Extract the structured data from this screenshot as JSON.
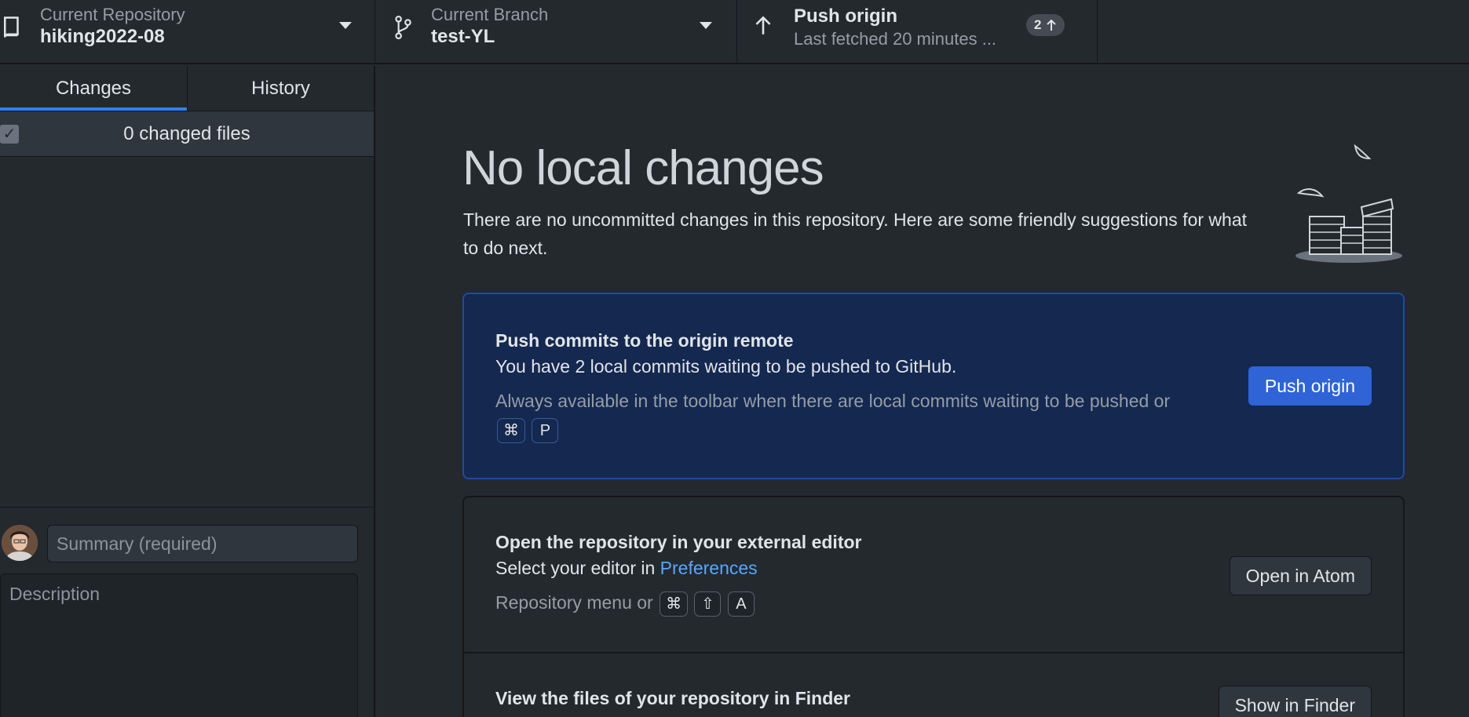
{
  "toolbar": {
    "repository": {
      "label": "Current Repository",
      "value": "hiking2022-08"
    },
    "branch": {
      "label": "Current Branch",
      "value": "test-YL"
    },
    "push": {
      "title": "Push origin",
      "subtitle": "Last fetched 20 minutes ...",
      "count": "2"
    }
  },
  "sidebar": {
    "tabs": [
      {
        "label": "Changes",
        "active": true
      },
      {
        "label": "History",
        "active": false
      }
    ],
    "files_count": "0 changed files",
    "summary_placeholder": "Summary (required)",
    "description_placeholder": "Description"
  },
  "main": {
    "headline": "No local changes",
    "intro": "There are no uncommitted changes in this repository. Here are some friendly suggestions for what to do next.",
    "push_card": {
      "title": "Push commits to the origin remote",
      "description": "You have 2 local commits waiting to be pushed to GitHub.",
      "hint": "Always available in the toolbar when there are local commits waiting to be pushed or",
      "keys": [
        "⌘",
        "P"
      ],
      "button": "Push origin"
    },
    "editor_card": {
      "title": "Open the repository in your external editor",
      "description_prefix": "Select your editor in",
      "link": "Preferences",
      "hint": "Repository menu or",
      "keys": [
        "⌘",
        "⇧",
        "A"
      ],
      "button": "Open in Atom"
    },
    "finder_card": {
      "title": "View the files of your repository in Finder",
      "button": "Show in Finder"
    }
  },
  "colors": {
    "background": "#24292e",
    "accent": "#2f81f7",
    "primary_card": "#142850",
    "primary_button": "#2f63d6",
    "link": "#58a6ff"
  },
  "icons": [
    "repo-icon",
    "branch-icon",
    "arrow-up-icon",
    "chevron-down-icon",
    "check-icon"
  ]
}
